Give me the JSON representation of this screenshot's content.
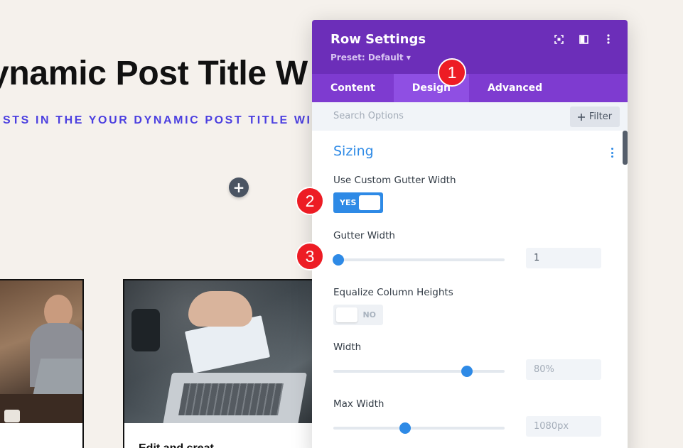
{
  "page": {
    "title": "ynamic Post Title W",
    "subtitle": "STS IN THE YOUR DYNAMIC POST TITLE WILL",
    "add_button": "+",
    "card_b_text": "Edit and creat"
  },
  "panel": {
    "title": "Row Settings",
    "preset": "Preset: Default ▾",
    "tabs": [
      {
        "label": "Content"
      },
      {
        "label": "Design",
        "active": true
      },
      {
        "label": "Advanced"
      }
    ],
    "search_placeholder": "Search Options",
    "filter_label": "Filter",
    "section_title": "Sizing",
    "fields": {
      "custom_gutter": {
        "label": "Use Custom Gutter Width",
        "state": "YES"
      },
      "gutter_width": {
        "label": "Gutter Width",
        "value": "1",
        "slider_fraction": 0.03
      },
      "equalize": {
        "label": "Equalize Column Heights",
        "state": "NO"
      },
      "width": {
        "label": "Width",
        "value": "80%",
        "slider_fraction": 0.78
      },
      "max_width": {
        "label": "Max Width",
        "value": "1080px",
        "slider_fraction": 0.42
      }
    }
  },
  "annotations": [
    "1",
    "2",
    "3"
  ],
  "colors": {
    "header": "#6c2eb9",
    "tabs": "#7e3bd0",
    "active_tab": "#8f4fe3",
    "accent": "#2e8ae6",
    "badge": "#ed1c24",
    "subtitle": "#4b3fe0"
  }
}
